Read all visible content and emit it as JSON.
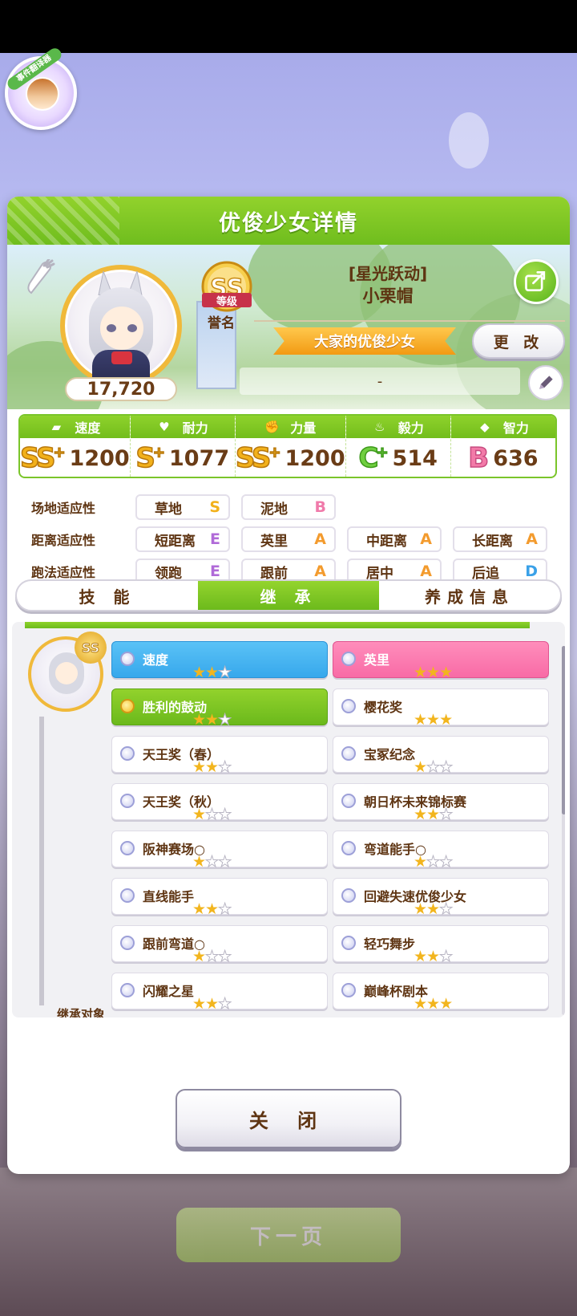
{
  "translator_badge": {
    "label": "事件翻译器"
  },
  "panel": {
    "title": "优俊少女详情"
  },
  "profile": {
    "score": "17,720",
    "rank": {
      "grade": "SS",
      "label": "等级"
    },
    "epithet_label": "誉名",
    "costume": "[星光跃动]",
    "name": "小栗帽",
    "title": "大家的优俊少女",
    "change_label": "更 改",
    "memo": "-"
  },
  "stats": [
    {
      "label": "速度",
      "icon": "shoe-icon",
      "grade": "SS",
      "plus": true,
      "value": "1200",
      "grade_color": "#f2b11b"
    },
    {
      "label": "耐力",
      "icon": "heart-icon",
      "grade": "S",
      "plus": true,
      "value": "1077",
      "grade_color": "#f2b11b"
    },
    {
      "label": "力量",
      "icon": "arm-icon",
      "grade": "SS",
      "plus": true,
      "value": "1200",
      "grade_color": "#f2b11b"
    },
    {
      "label": "毅力",
      "icon": "flame-icon",
      "grade": "C",
      "plus": true,
      "value": "514",
      "grade_color": "#6fcf3f"
    },
    {
      "label": "智力",
      "icon": "graduation-cap-icon",
      "grade": "B",
      "plus": false,
      "value": "636",
      "grade_color": "#f27aa8"
    }
  ],
  "aptitude": {
    "track": {
      "title": "场地适应性",
      "items": [
        {
          "label": "草地",
          "grade": "S"
        },
        {
          "label": "泥地",
          "grade": "B"
        }
      ]
    },
    "distance": {
      "title": "距离适应性",
      "items": [
        {
          "label": "短距离",
          "grade": "E"
        },
        {
          "label": "英里",
          "grade": "A"
        },
        {
          "label": "中距离",
          "grade": "A"
        },
        {
          "label": "长距离",
          "grade": "A"
        }
      ]
    },
    "style": {
      "title": "跑法适应性",
      "items": [
        {
          "label": "领跑",
          "grade": "E"
        },
        {
          "label": "跟前",
          "grade": "A"
        },
        {
          "label": "居中",
          "grade": "A"
        },
        {
          "label": "后追",
          "grade": "D"
        }
      ]
    }
  },
  "tabs": [
    {
      "label": "技 能",
      "active": false
    },
    {
      "label": "继 承",
      "active": true
    },
    {
      "label": "养成信息",
      "active": false
    }
  ],
  "inherit": {
    "mini_rank": "SS",
    "factors_left": [
      {
        "name": "速度",
        "stars": 2,
        "type": "blue"
      },
      {
        "name": "胜利的鼓动",
        "stars": 2,
        "type": "green"
      },
      {
        "name": "天王奖（春）",
        "stars": 2,
        "type": "white"
      },
      {
        "name": "天王奖（秋）",
        "stars": 1,
        "type": "white"
      },
      {
        "name": "阪神赛场○",
        "stars": 1,
        "type": "white"
      },
      {
        "name": "直线能手",
        "stars": 2,
        "type": "white"
      },
      {
        "name": "跟前弯道○",
        "stars": 1,
        "type": "white"
      },
      {
        "name": "闪耀之星",
        "stars": 2,
        "type": "white"
      }
    ],
    "factors_right": [
      {
        "name": "英里",
        "stars": 3,
        "type": "pink"
      },
      {
        "name": "樱花奖",
        "stars": 3,
        "type": "white"
      },
      {
        "name": "宝冢纪念",
        "stars": 1,
        "type": "white"
      },
      {
        "name": "朝日杯未来锦标赛",
        "stars": 2,
        "type": "white"
      },
      {
        "name": "弯道能手○",
        "stars": 1,
        "type": "white"
      },
      {
        "name": "回避失速优俊少女",
        "stars": 2,
        "type": "white"
      },
      {
        "name": "轻巧舞步",
        "stars": 2,
        "type": "white"
      },
      {
        "name": "巅峰杯剧本",
        "stars": 3,
        "type": "white"
      }
    ],
    "target_label": "继承对象"
  },
  "close_label": "关 闭",
  "next_label": "下一页"
}
